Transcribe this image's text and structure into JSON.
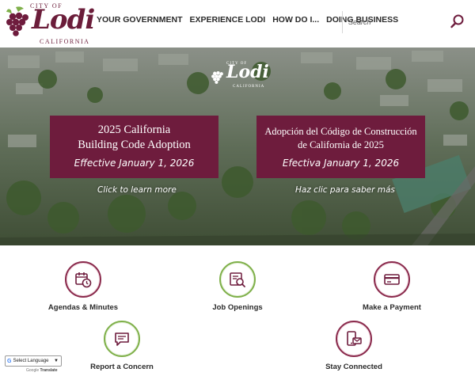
{
  "header": {
    "logo": {
      "city_of": "CITY OF",
      "name": "Lodi",
      "state": "CALIFORNIA"
    },
    "nav": [
      "YOUR GOVERNMENT",
      "EXPERIENCE LODI",
      "HOW DO I...",
      "DOING BUSINESS"
    ],
    "search": {
      "placeholder": "Search",
      "icon": "search-icon"
    }
  },
  "hero": {
    "logo": {
      "city_of": "CITY OF",
      "name": "Lodi",
      "state": "CALIFORNIA"
    },
    "cards": [
      {
        "line1": "2025 California",
        "line2": "Building Code Adoption",
        "line3": "Effective January 1, 2026",
        "link": "Click to learn more"
      },
      {
        "line1": "Adopción del Código de Construcción",
        "line2": "de California de 2025",
        "line3": "Efectiva January 1, 2026",
        "link": "Haz clic para saber más"
      }
    ],
    "card_color": "#6e1c3d"
  },
  "quick_links": [
    {
      "label": "Agendas & Minutes",
      "icon": "calendar-clock-icon",
      "ring": "#8a2a4c"
    },
    {
      "label": "Job Openings",
      "icon": "job-search-icon",
      "ring": "#7fb04a"
    },
    {
      "label": "Make a Payment",
      "icon": "credit-card-icon",
      "ring": "#8a2a4c"
    },
    {
      "label": "Report a Concern",
      "icon": "chat-bubble-icon",
      "ring": "#7fb04a"
    },
    {
      "label": "Stay Connected",
      "icon": "phone-mail-icon",
      "ring": "#8a2a4c"
    }
  ],
  "translate": {
    "select_label": "Select Language",
    "powered_by": "Google",
    "powered_word": "Translate"
  },
  "colors": {
    "brand": "#6e1c3d",
    "accent_green": "#7fb04a"
  }
}
